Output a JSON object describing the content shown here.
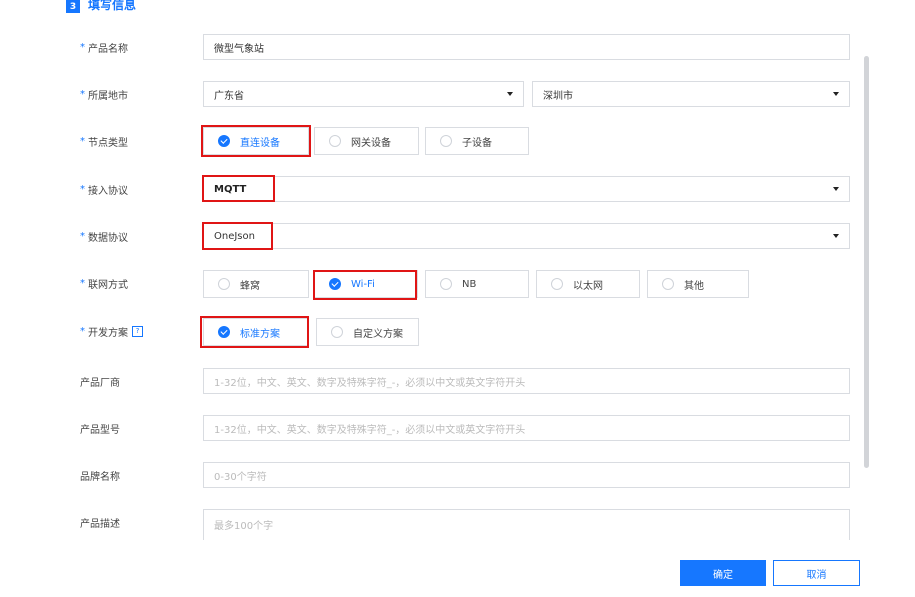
{
  "section": {
    "step": "3",
    "title": "填写信息"
  },
  "fields": {
    "product_name": {
      "label": "产品名称",
      "value": "微型气象站"
    },
    "region": {
      "label": "所属地市",
      "province": "广东省",
      "city": "深圳市"
    },
    "node_type": {
      "label": "节点类型",
      "options": [
        "直连设备",
        "网关设备",
        "子设备"
      ],
      "selected": "直连设备"
    },
    "access_protocol": {
      "label": "接入协议",
      "value": "MQTT"
    },
    "data_protocol": {
      "label": "数据协议",
      "value": "OneJson"
    },
    "network": {
      "label": "联网方式",
      "options": [
        "蜂窝",
        "Wi-Fi",
        "NB",
        "以太网",
        "其他"
      ],
      "selected": "Wi-Fi"
    },
    "dev_plan": {
      "label": "开发方案",
      "help_icon": "?",
      "options": [
        "标准方案",
        "自定义方案"
      ],
      "selected": "标准方案"
    },
    "manufacturer": {
      "label": "产品厂商",
      "placeholder": "1-32位，中文、英文、数字及特殊字符_-，必须以中文或英文字符开头"
    },
    "model": {
      "label": "产品型号",
      "placeholder": "1-32位，中文、英文、数字及特殊字符_-，必须以中文或英文字符开头"
    },
    "brand": {
      "label": "品牌名称",
      "placeholder": "0-30个字符"
    },
    "description": {
      "label": "产品描述",
      "placeholder": "最多100个字"
    }
  },
  "required_mark": "*",
  "buttons": {
    "ok": "确定",
    "cancel": "取消"
  },
  "colors": {
    "accent": "#1677ff",
    "highlight": "#e01515",
    "border": "#d9dce1"
  }
}
